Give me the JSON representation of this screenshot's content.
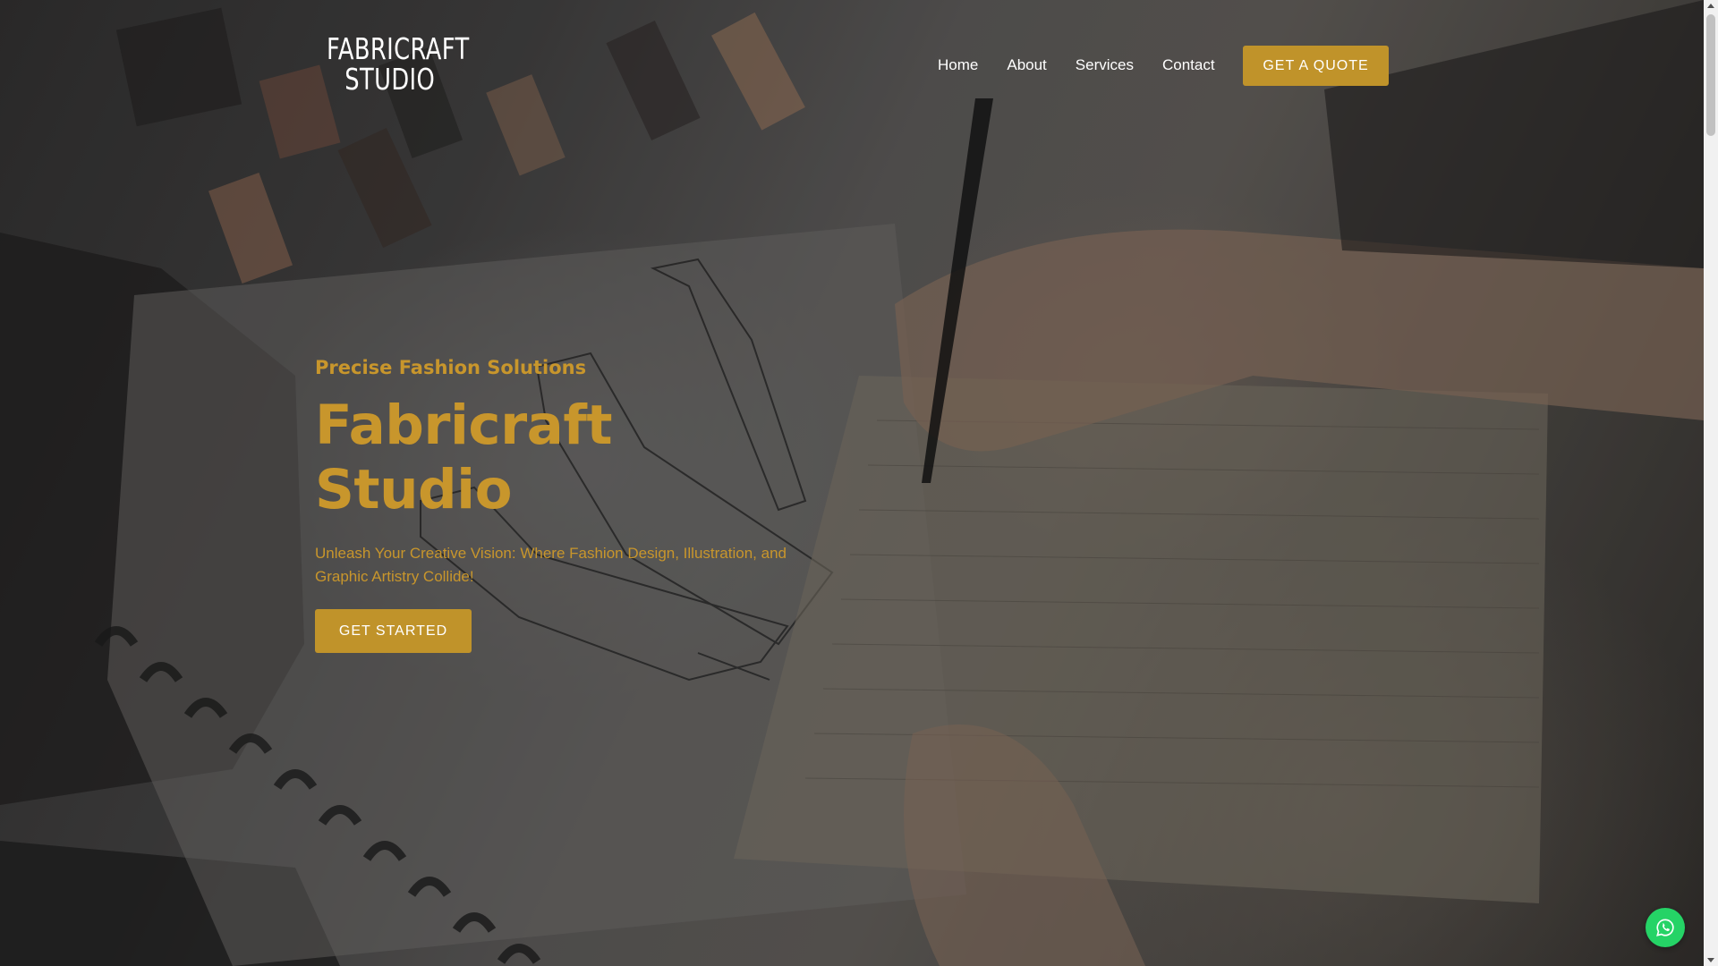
{
  "brand": {
    "name_line1": "FABRICRAFT",
    "name_line2": "STUDIO",
    "accent_color": "#c0932a"
  },
  "nav": {
    "items": [
      {
        "label": "Home"
      },
      {
        "label": "About"
      },
      {
        "label": "Services"
      },
      {
        "label": "Contact"
      }
    ],
    "cta_label": "GET A QUOTE"
  },
  "hero": {
    "tagline": "Precise Fashion Solutions",
    "title": "Fabricraft Studio",
    "subtitle": "Unleash Your Creative Vision: Where Fashion Design, Illustration, and Graphic Artistry Collide!",
    "cta_label": "GET STARTED",
    "background": "fashion-sketch-photo"
  },
  "floating": {
    "whatsapp_icon": "whatsapp-icon",
    "whatsapp_color": "#25d366"
  }
}
